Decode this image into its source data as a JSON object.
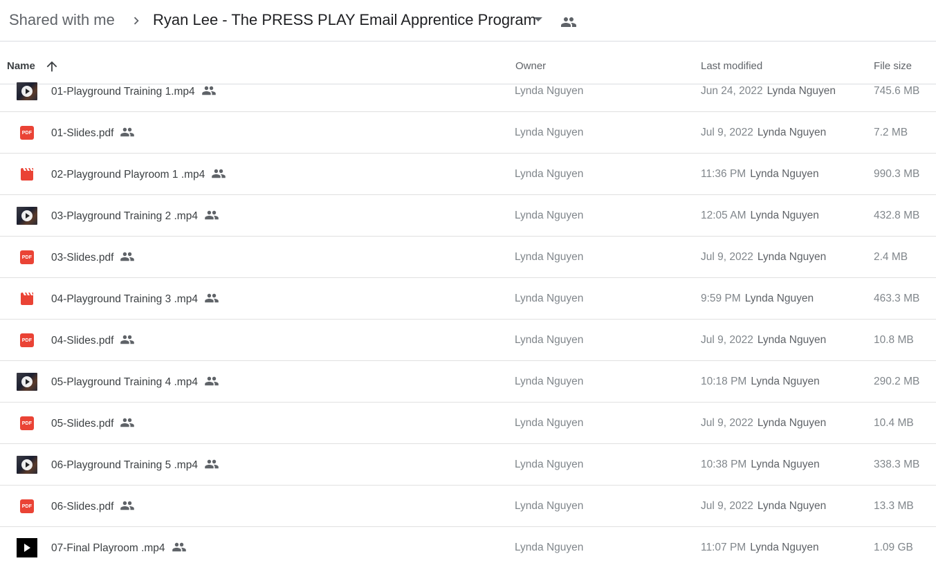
{
  "breadcrumb": {
    "root": "Shared with me",
    "current": "Ryan Lee - The PRESS PLAY Email Apprentice Program"
  },
  "columns": {
    "name": "Name",
    "owner": "Owner",
    "last_modified": "Last modified",
    "file_size": "File size"
  },
  "colors": {
    "pdf": "#ea4335",
    "video": "#ea4335",
    "divider": "#dadce0"
  },
  "files": [
    {
      "name": "01-Playground Training 1.mp4",
      "icon": "video-thumbnail-icon",
      "owner": "Lynda Nguyen",
      "modified": "Jun 24, 2022",
      "modified_by": "Lynda Nguyen",
      "size": "745.6 MB"
    },
    {
      "name": "01-Slides.pdf",
      "icon": "pdf-icon",
      "owner": "Lynda Nguyen",
      "modified": "Jul 9, 2022",
      "modified_by": "Lynda Nguyen",
      "size": "7.2 MB"
    },
    {
      "name": "02-Playground Playroom 1 .mp4",
      "icon": "video-file-icon",
      "owner": "Lynda Nguyen",
      "modified": "11:36 PM",
      "modified_by": "Lynda Nguyen",
      "size": "990.3 MB"
    },
    {
      "name": "03-Playground Training 2 .mp4",
      "icon": "video-thumbnail-icon",
      "owner": "Lynda Nguyen",
      "modified": "12:05 AM",
      "modified_by": "Lynda Nguyen",
      "size": "432.8 MB"
    },
    {
      "name": "03-Slides.pdf",
      "icon": "pdf-icon",
      "owner": "Lynda Nguyen",
      "modified": "Jul 9, 2022",
      "modified_by": "Lynda Nguyen",
      "size": "2.4 MB"
    },
    {
      "name": "04-Playground Training 3 .mp4",
      "icon": "video-file-icon",
      "owner": "Lynda Nguyen",
      "modified": "9:59 PM",
      "modified_by": "Lynda Nguyen",
      "size": "463.3 MB"
    },
    {
      "name": "04-Slides.pdf",
      "icon": "pdf-icon",
      "owner": "Lynda Nguyen",
      "modified": "Jul 9, 2022",
      "modified_by": "Lynda Nguyen",
      "size": "10.8 MB"
    },
    {
      "name": "05-Playground Training 4 .mp4",
      "icon": "video-thumbnail-icon",
      "owner": "Lynda Nguyen",
      "modified": "10:18 PM",
      "modified_by": "Lynda Nguyen",
      "size": "290.2 MB"
    },
    {
      "name": "05-Slides.pdf",
      "icon": "pdf-icon",
      "owner": "Lynda Nguyen",
      "modified": "Jul 9, 2022",
      "modified_by": "Lynda Nguyen",
      "size": "10.4 MB"
    },
    {
      "name": "06-Playground Training 5 .mp4",
      "icon": "video-thumbnail-icon",
      "owner": "Lynda Nguyen",
      "modified": "10:38 PM",
      "modified_by": "Lynda Nguyen",
      "size": "338.3 MB"
    },
    {
      "name": "06-Slides.pdf",
      "icon": "pdf-icon",
      "owner": "Lynda Nguyen",
      "modified": "Jul 9, 2022",
      "modified_by": "Lynda Nguyen",
      "size": "13.3 MB"
    },
    {
      "name": "07-Final Playroom .mp4",
      "icon": "video-black-thumbnail-icon",
      "owner": "Lynda Nguyen",
      "modified": "11:07 PM",
      "modified_by": "Lynda Nguyen",
      "size": "1.09 GB"
    }
  ]
}
